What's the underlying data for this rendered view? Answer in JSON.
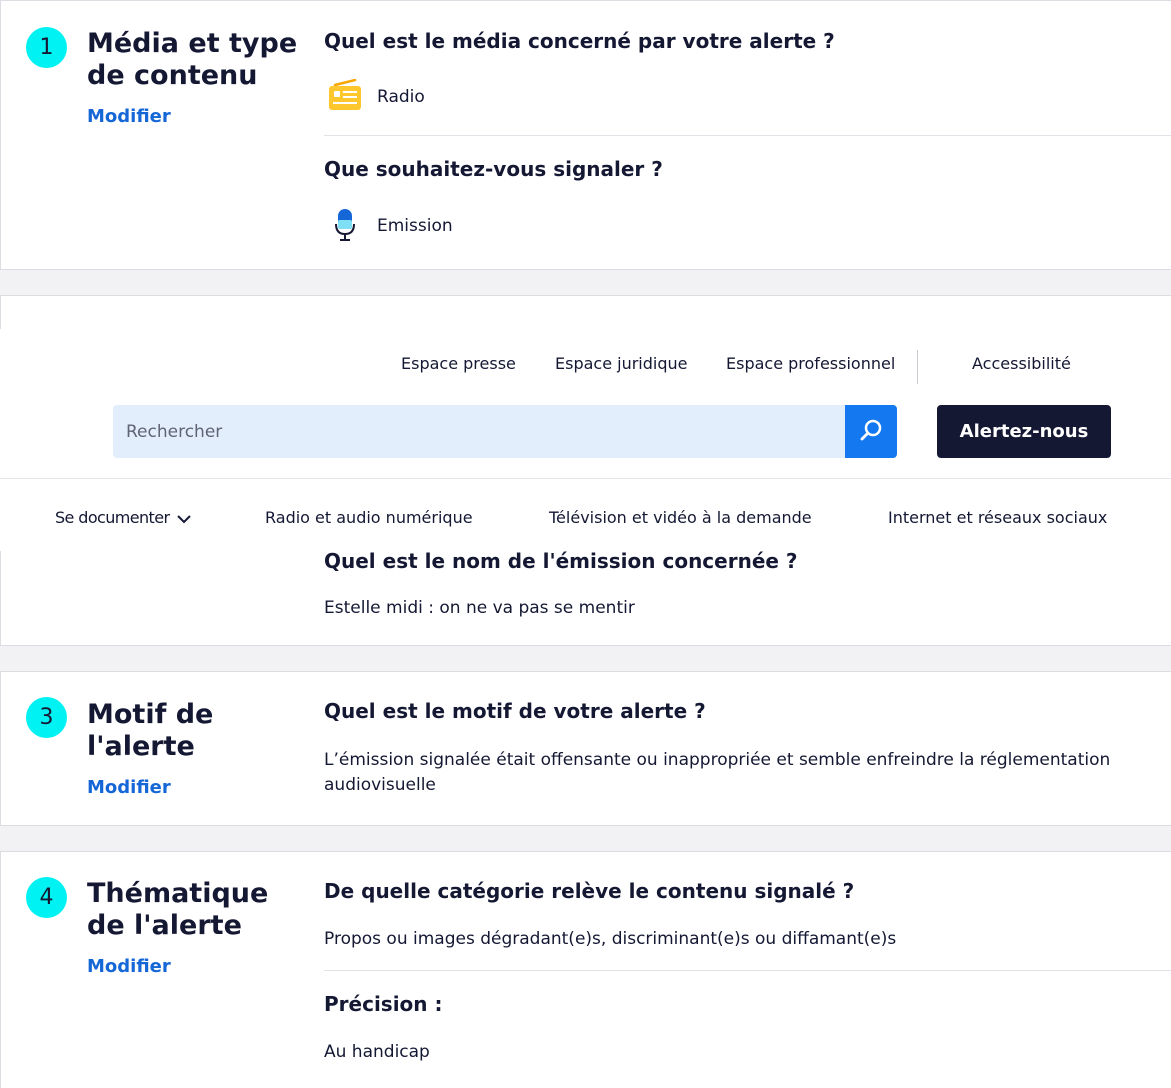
{
  "sections": {
    "s1": {
      "number": "1",
      "title": "Média et type de contenu",
      "modify": "Modifier",
      "q1": "Quel est le média concerné par votre alerte ?",
      "a1": "Radio",
      "a1_icon": "radio-icon",
      "q2": "Que souhaitez-vous signaler ?",
      "a2": "Emission",
      "a2_icon": "microphone-icon"
    },
    "s2": {
      "q_name": "Quel est le nom de l'émission concernée ?",
      "a_name": "Estelle midi : on ne va pas se mentir"
    },
    "s3": {
      "number": "3",
      "title": "Motif de l'alerte",
      "modify": "Modifier",
      "q": "Quel est le motif de votre alerte ?",
      "a": "L’émission signalée était offensante ou inappropriée et semble enfreindre la réglementation audiovisuelle"
    },
    "s4": {
      "number": "4",
      "title": "Thématique de l'alerte",
      "modify": "Modifier",
      "q1": "De quelle catégorie relève le contenu signalé ?",
      "a1": "Propos ou images dégradant(e)s, discriminant(e)s ou diffamant(e)s",
      "q2": "Précision :",
      "a2": "Au handicap"
    }
  },
  "header": {
    "toplinks": [
      "Espace presse",
      "Espace juridique",
      "Espace professionnel",
      "Accessibilité"
    ],
    "search_placeholder": "Rechercher",
    "search_icon": "search-icon",
    "alert_button": "Alertez-nous",
    "nav": [
      "Se documenter",
      "Radio et audio numérique",
      "Télévision et vidéo à la demande",
      "Internet et réseaux sociaux"
    ]
  },
  "colors": {
    "step_badge": "#00f2f2",
    "link": "#1566d6",
    "navy": "#141833",
    "search_button": "#1479f0",
    "search_field": "#e3eefc"
  }
}
